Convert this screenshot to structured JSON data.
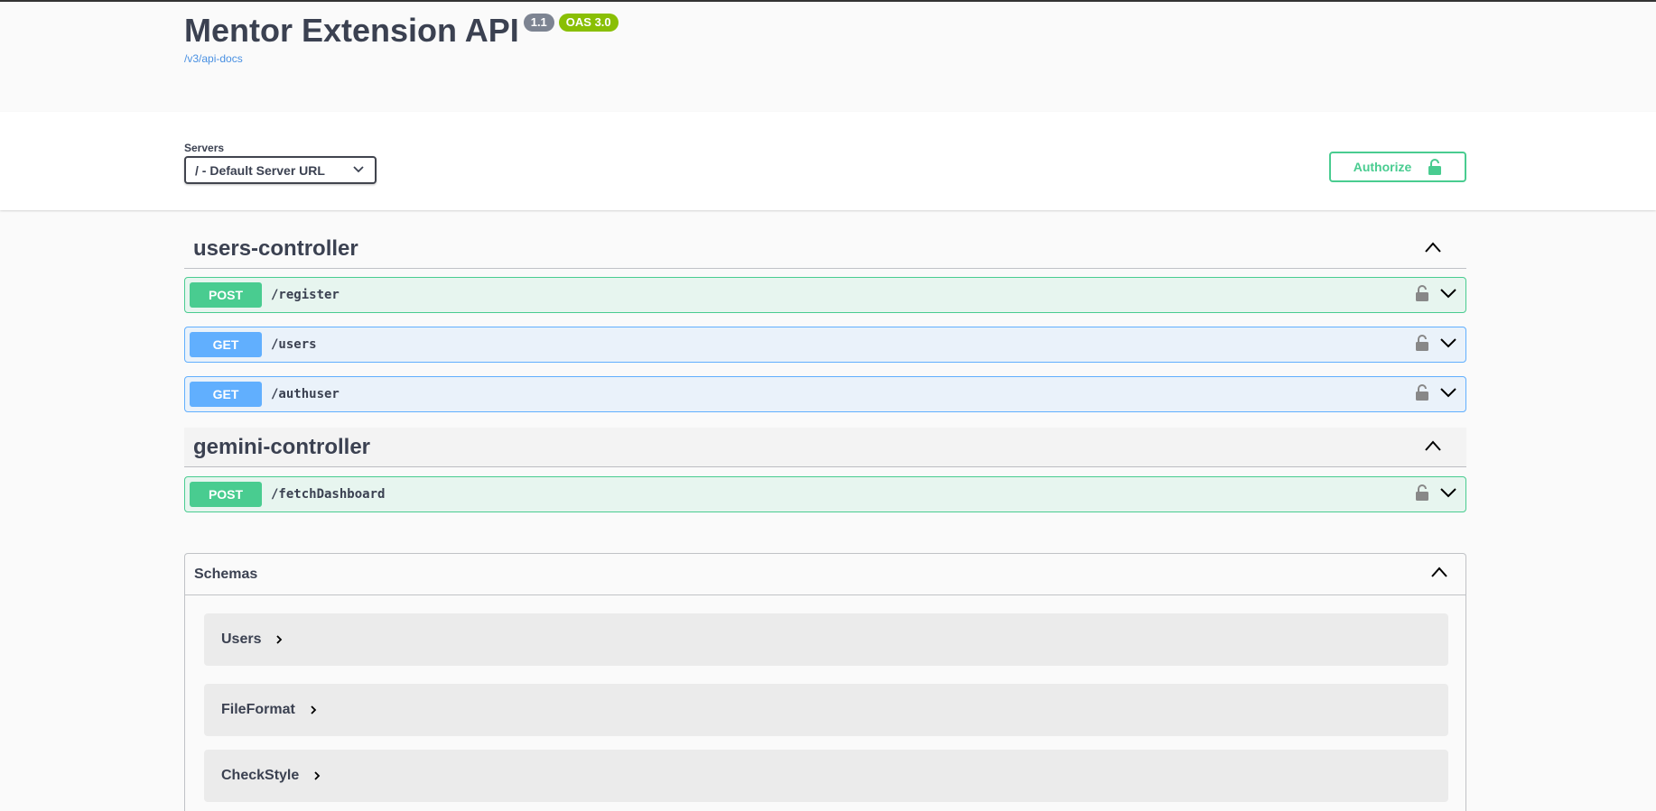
{
  "info": {
    "title": "Mentor Extension API",
    "version_badge": "1.1",
    "oas_badge": "OAS 3.0",
    "spec_link": "/v3/api-docs"
  },
  "servers": {
    "label": "Servers",
    "selected": "/ - Default Server URL"
  },
  "authorize": {
    "label": "Authorize"
  },
  "tags": [
    {
      "name": "users-controller",
      "operations": [
        {
          "method": "POST",
          "path": "/register"
        },
        {
          "method": "GET",
          "path": "/users"
        },
        {
          "method": "GET",
          "path": "/authuser"
        }
      ]
    },
    {
      "name": "gemini-controller",
      "operations": [
        {
          "method": "POST",
          "path": "/fetchDashboard"
        }
      ]
    }
  ],
  "schemas": {
    "title": "Schemas",
    "items": [
      "Users",
      "FileFormat",
      "CheckStyle"
    ]
  },
  "colors": {
    "post": "#49cc90",
    "get": "#61affe",
    "link": "#4990e2",
    "oas_badge": "#89bf04",
    "version_badge": "#7d8492"
  }
}
